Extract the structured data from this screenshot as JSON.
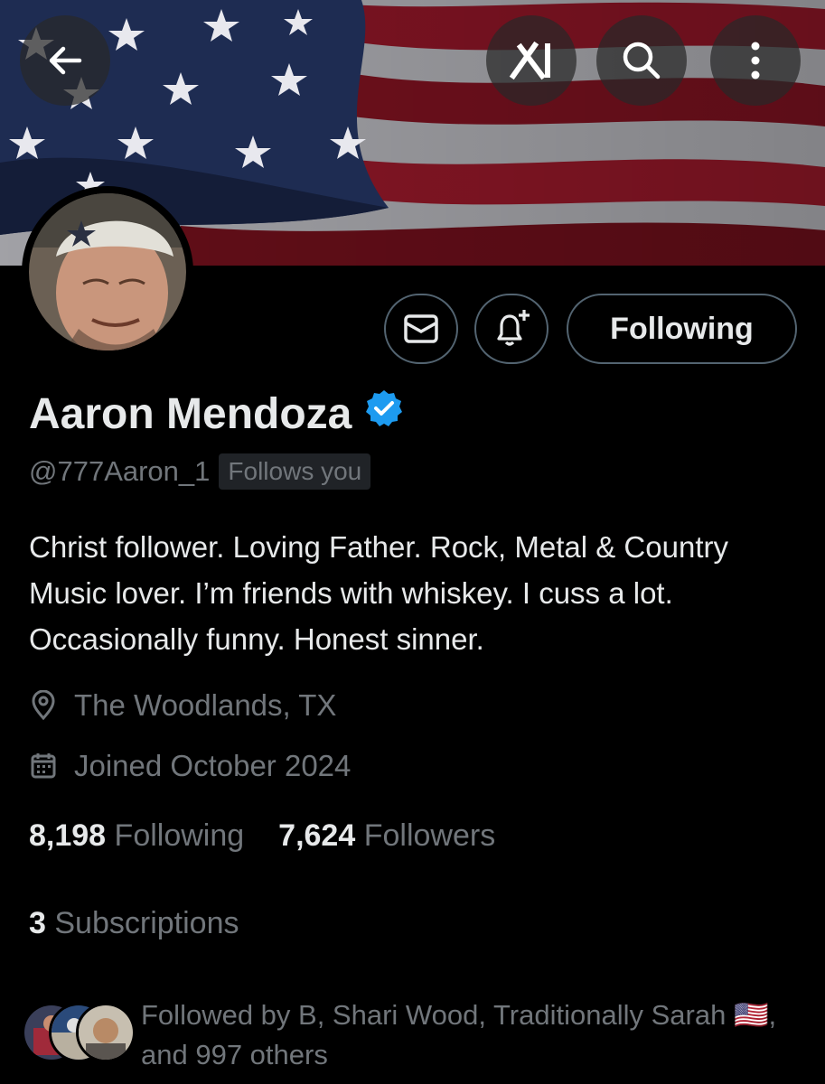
{
  "header": {
    "back_icon": "arrow-left-icon",
    "grok_icon": "grok-logo-icon",
    "search_icon": "search-icon",
    "more_icon": "more-vertical-icon"
  },
  "profile": {
    "display_name": "Aaron Mendoza",
    "verified": true,
    "handle": "@777Aaron_1",
    "follows_you": "Follows you",
    "bio": "Christ follower. Loving Father. Rock, Metal & Country Music lover. I’m friends with whiskey. I cuss a lot. Occasionally funny. Honest sinner.",
    "location": "The Woodlands, TX",
    "joined": "Joined October 2024"
  },
  "actions": {
    "message_icon": "envelope-icon",
    "notify_icon": "bell-plus-icon",
    "following_label": "Following"
  },
  "stats": {
    "following_count": "8,198",
    "following_label": "Following",
    "followers_count": "7,624",
    "followers_label": "Followers",
    "subscriptions_count": "3",
    "subscriptions_label": "Subscriptions"
  },
  "followed_by": {
    "text_line1": "Followed by B, Shari Wood, Traditionally Sarah",
    "flag": "🇺🇸",
    "text_line2": ", and 997 others"
  },
  "colors": {
    "accent_verified": "#1d9bf0",
    "text_primary": "#e7e9ea",
    "text_secondary": "#71767b",
    "border": "#536471",
    "background": "#000000"
  }
}
